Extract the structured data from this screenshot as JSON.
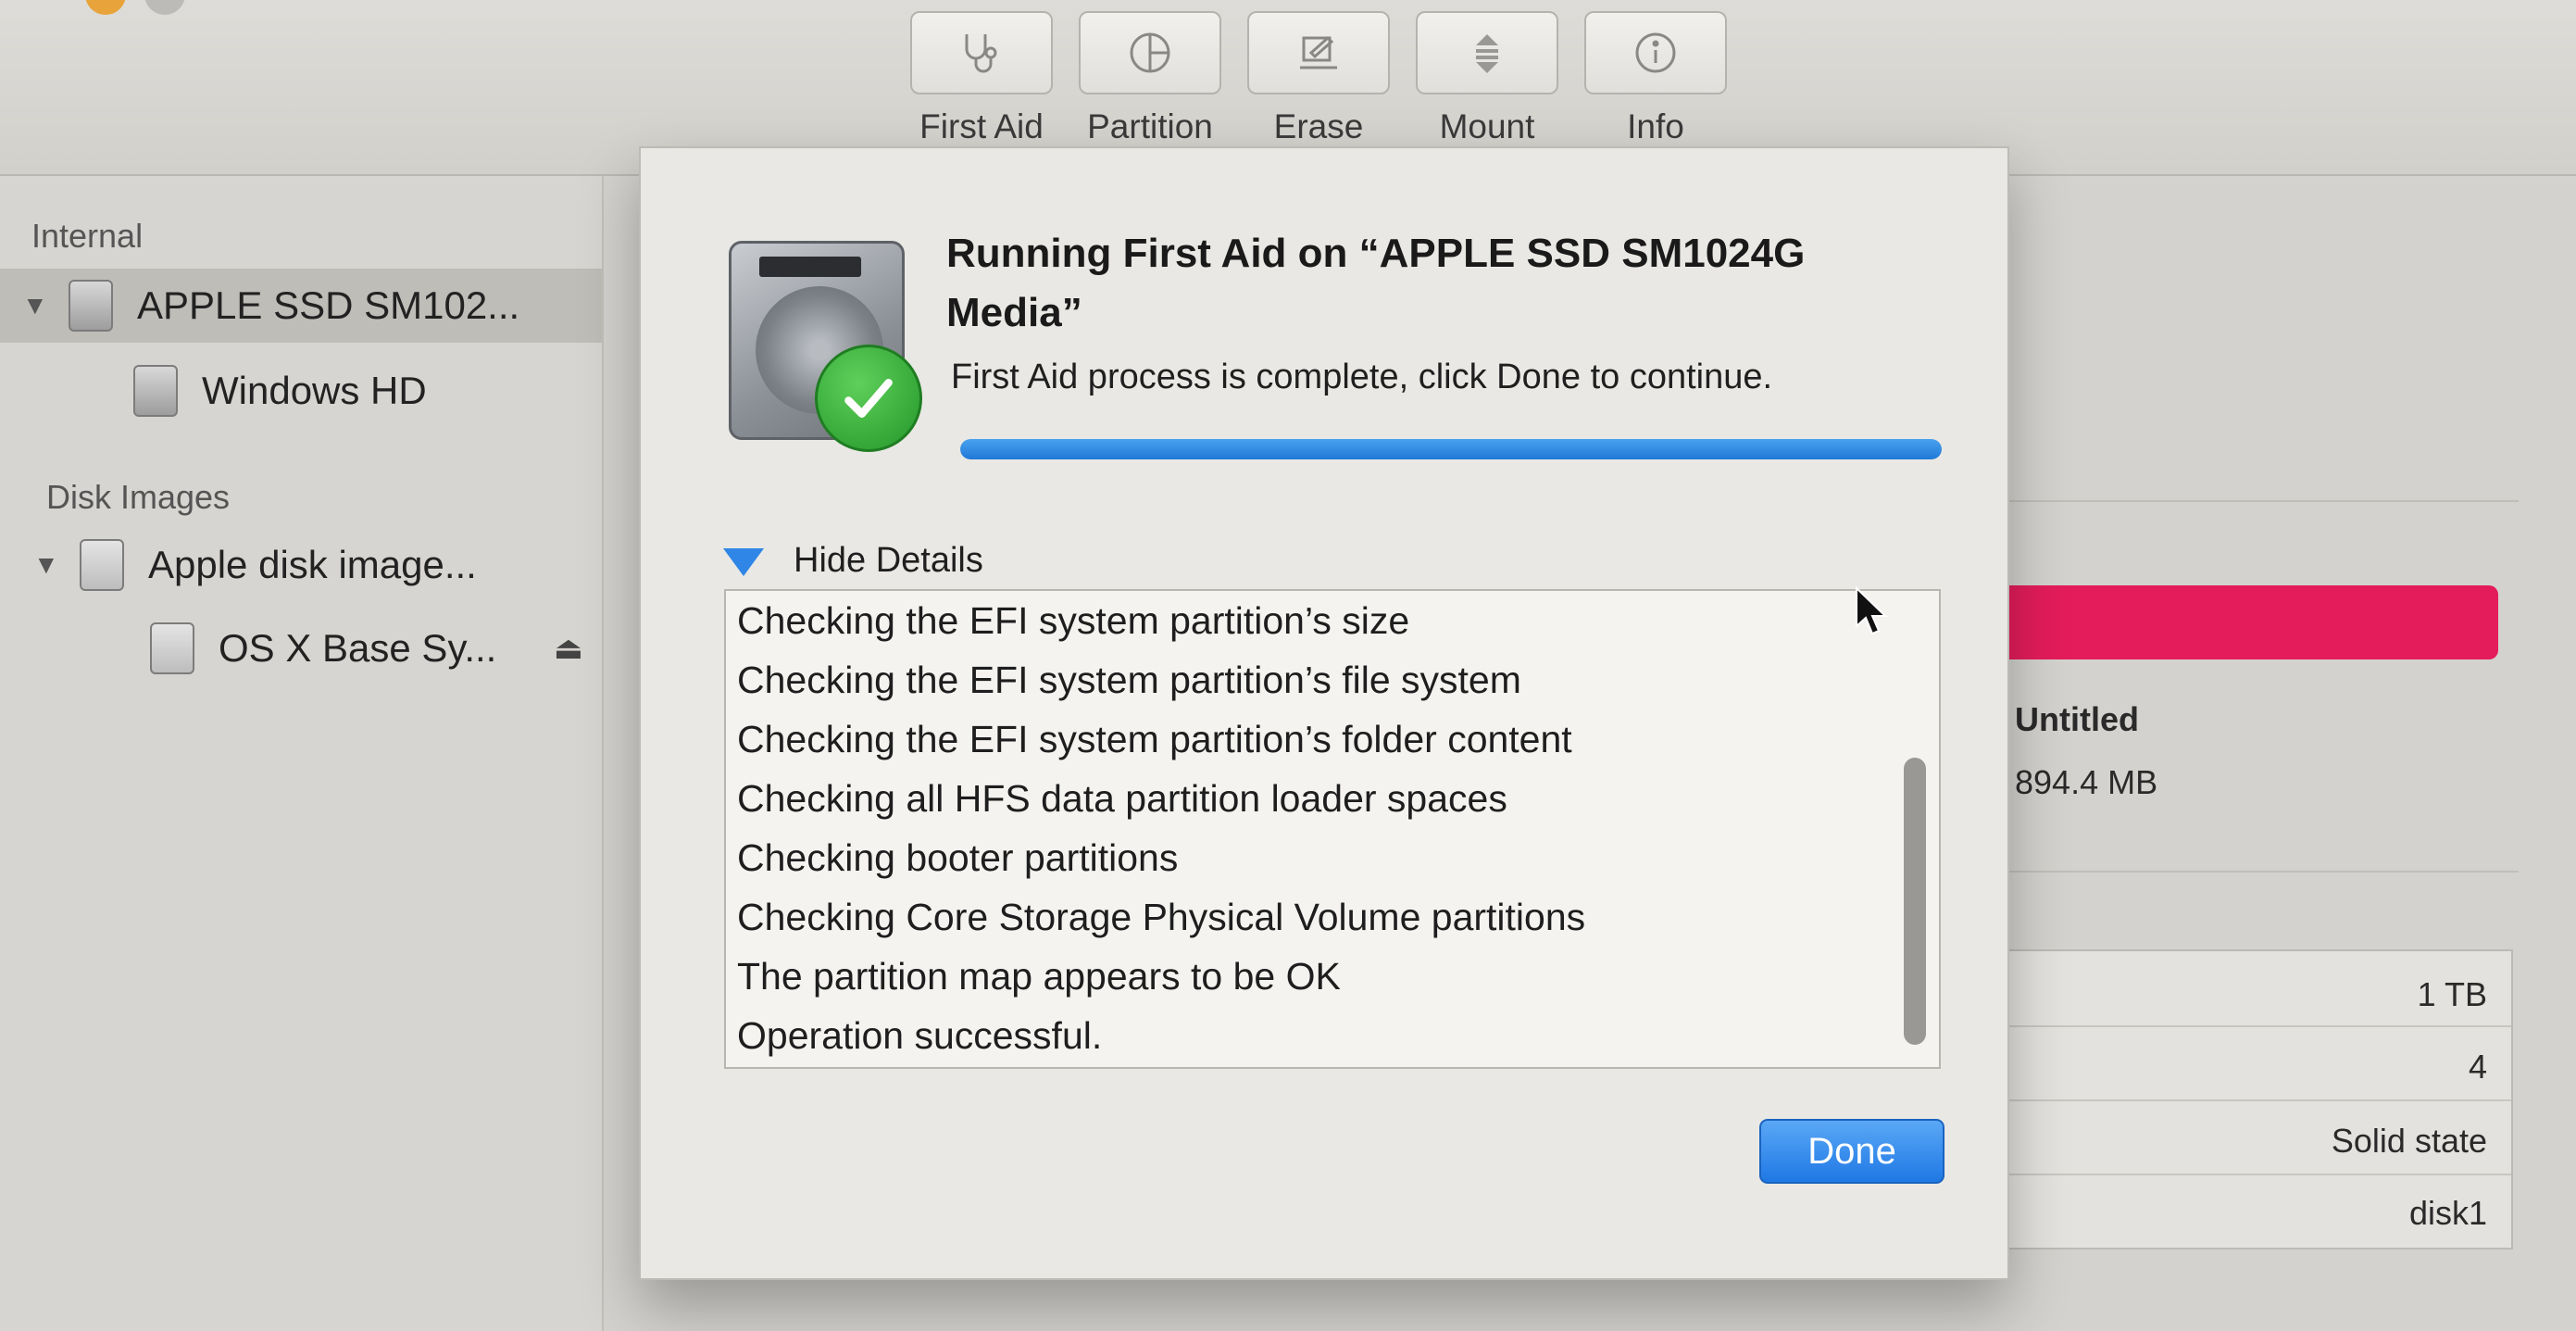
{
  "toolbar": {
    "items": [
      {
        "label": "First Aid",
        "icon": "stethoscope-icon"
      },
      {
        "label": "Partition",
        "icon": "pie-chart-icon"
      },
      {
        "label": "Erase",
        "icon": "eraser-icon"
      },
      {
        "label": "Mount",
        "icon": "mount-icon"
      },
      {
        "label": "Info",
        "icon": "info-icon"
      }
    ]
  },
  "sidebar": {
    "internal_header": "Internal",
    "disk_images_header": "Disk Images",
    "items": [
      {
        "label": "APPLE SSD SM102..."
      },
      {
        "label": "Windows HD"
      },
      {
        "label": "Apple disk image..."
      },
      {
        "label": "OS X Base Sy..."
      }
    ],
    "eject_symbol": "⏏"
  },
  "background_panel": {
    "volume_name": "Untitled",
    "volume_size": "894.4 MB",
    "usage_color": "#e41c5b",
    "info_rows": [
      "1 TB",
      "4",
      "Solid state",
      "disk1"
    ]
  },
  "dialog": {
    "title": "Running First Aid on “APPLE SSD SM1024G Media”",
    "status": "First Aid process is complete, click Done to continue.",
    "progress": 1.0,
    "details_toggle_label": "Hide Details",
    "log_lines": [
      "Checking the EFI system partition’s size",
      "Checking the EFI system partition’s file system",
      "Checking the EFI system partition’s folder content",
      "Checking all HFS data partition loader spaces",
      "Checking booter partitions",
      "Checking Core Storage Physical Volume partitions",
      "The partition map appears to be OK",
      "Operation successful."
    ],
    "done_label": "Done",
    "accent_color": "#1f78e4"
  }
}
